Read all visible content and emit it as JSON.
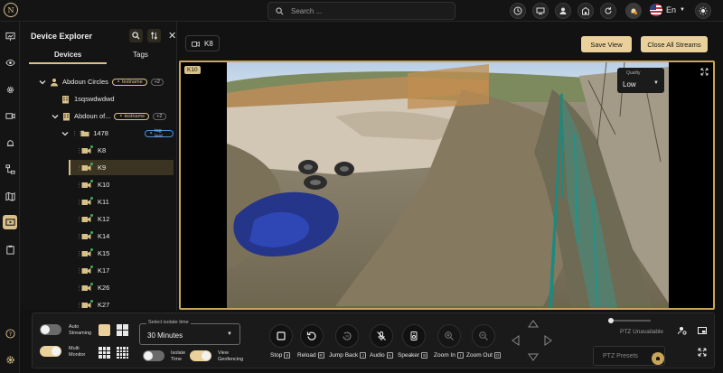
{
  "header": {
    "logo_text": "N",
    "search_placeholder": "Search ...",
    "language": "En",
    "buttons": [
      "clock-icon",
      "monitor-icon",
      "user-icon",
      "building-icon",
      "refresh-icon",
      "sun-icon"
    ]
  },
  "explorer": {
    "title": "Device Explorer",
    "tabs": [
      {
        "label": "Devices",
        "active": true
      },
      {
        "label": "Tags",
        "active": false
      }
    ],
    "tree": [
      {
        "label": "Abdoun Circles",
        "type": "org",
        "badge": "testname",
        "count": "+2"
      },
      {
        "label": "1sqswdwdwd",
        "type": "site"
      },
      {
        "label": "Abdoun of...",
        "type": "site",
        "badge": "testname",
        "count": "+2"
      },
      {
        "label": "1478",
        "type": "folder",
        "badge": "tag test"
      },
      {
        "label": "K8",
        "type": "camera",
        "selected": false
      },
      {
        "label": "K9",
        "type": "camera",
        "selected": true
      },
      {
        "label": "K10",
        "type": "camera"
      },
      {
        "label": "K11",
        "type": "camera"
      },
      {
        "label": "K12",
        "type": "camera"
      },
      {
        "label": "K14",
        "type": "camera"
      },
      {
        "label": "K15",
        "type": "camera"
      },
      {
        "label": "K17",
        "type": "camera"
      },
      {
        "label": "K26",
        "type": "camera"
      },
      {
        "label": "K27",
        "type": "camera"
      }
    ]
  },
  "main": {
    "stream_tab": "K8",
    "save_view": "Save View",
    "close_all": "Close All Streams",
    "player": {
      "label": "K10",
      "quality_label": "Quality",
      "quality_value": "Low"
    }
  },
  "controls": {
    "auto_streaming": "Auto Streaming",
    "multi_monitor": "Multi Monitor",
    "isolate_time_label": "Select isolate time",
    "isolate_time_value": "30 Minutes",
    "isolate_time": "Isolate Time",
    "view_geofencing": "View Geofencing",
    "actions": [
      {
        "label": "Stop",
        "key": "S"
      },
      {
        "label": "Reload",
        "key": "R"
      },
      {
        "label": "Jump Back",
        "key": "J"
      },
      {
        "label": "Audio",
        "key": "A"
      },
      {
        "label": "Speaker",
        "key": "B"
      },
      {
        "label": "Zoom In",
        "key": "I"
      },
      {
        "label": "Zoom Out",
        "key": "O"
      }
    ],
    "ptz_status": "PTZ Unavailable",
    "ptz_preset": "PTZ Presets",
    "accent": "#ead09a"
  }
}
